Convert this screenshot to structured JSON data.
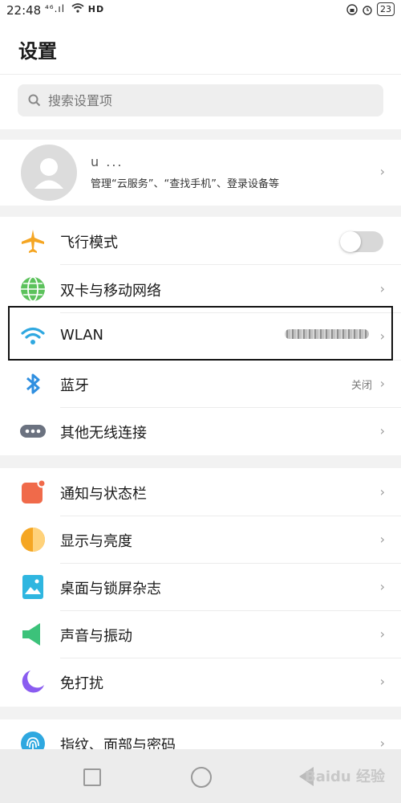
{
  "status_bar": {
    "time": "22:48",
    "signal_text": "⁴⁶.ıl",
    "wifi_icon": "wifi-icon",
    "hd_text": "HD",
    "battery": "23"
  },
  "header": {
    "title": "设置"
  },
  "search": {
    "placeholder": "搜索设置项"
  },
  "account": {
    "name": "u    ...",
    "subtitle": "管理“云服务”、“查找手机”、登录设备等"
  },
  "wireless": {
    "airplane": {
      "label": "飞行模式",
      "toggle_on": false
    },
    "sim_network": {
      "label": "双卡与移动网络"
    },
    "wlan": {
      "label": "WLAN"
    },
    "bluetooth": {
      "label": "蓝牙",
      "value": "关闭"
    },
    "other": {
      "label": "其他无线连接"
    }
  },
  "display_group": {
    "notifications": {
      "label": "通知与状态栏"
    },
    "display": {
      "label": "显示与亮度"
    },
    "desktop": {
      "label": "桌面与锁屏杂志"
    },
    "sound": {
      "label": "声音与振动"
    },
    "dnd": {
      "label": "免打扰"
    }
  },
  "security_group": {
    "fingerprint": {
      "label": "指纹、面部与密码"
    }
  },
  "chevron": "›",
  "watermark": "Baidu 经验",
  "colors": {
    "airplane": "#f5a623",
    "network": "#5cc25c",
    "wifi": "#2fa8e0",
    "bluetooth": "#2f8fe0",
    "other": "#6b7280",
    "notify": "#f06a4a",
    "display": "#f5a623",
    "desktop": "#2fb6e0",
    "sound": "#3cc27a",
    "dnd": "#8a5cf0",
    "fingerprint": "#2fa8e0"
  }
}
